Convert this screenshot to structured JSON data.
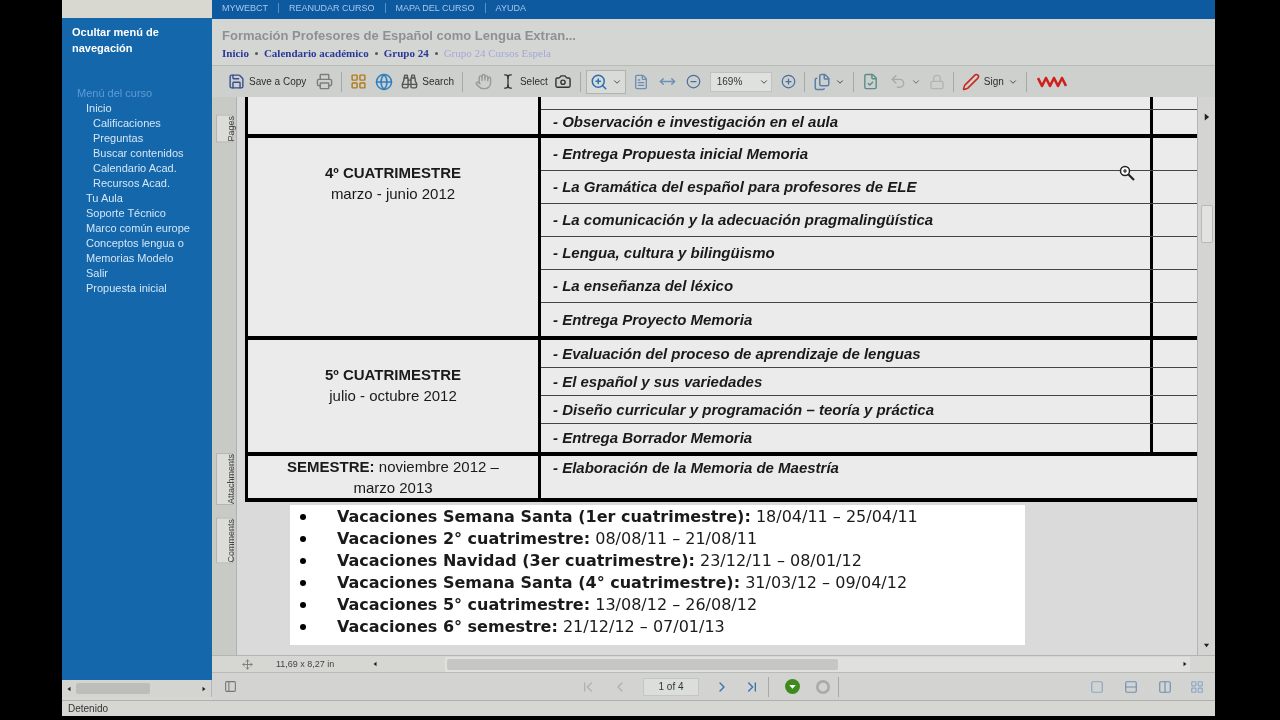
{
  "top_links": [
    "MYWEBCT",
    "REANUDAR CURSO",
    "MAPA DEL CURSO",
    "AYUDA"
  ],
  "sidebar": {
    "hide_link": "Ocultar menú de navegación",
    "menu_title": "Menú del curso",
    "items": [
      {
        "label": "Inicio",
        "children": [
          {
            "label": "Calificaciones"
          },
          {
            "label": "Preguntas"
          },
          {
            "label": "Buscar contenidos"
          },
          {
            "label": "Calendario Acad."
          },
          {
            "label": "Recursos Acad."
          }
        ]
      },
      {
        "label": "Tu Aula"
      },
      {
        "label": "Soporte Técnico"
      },
      {
        "label": "Marco común europe"
      },
      {
        "label": "Conceptos lengua o"
      },
      {
        "label": "Memorias Modelo"
      },
      {
        "label": "Salir"
      },
      {
        "label": "Propuesta inicial"
      }
    ]
  },
  "header": {
    "title": "Formación Profesores de Español como Lengua Extran...",
    "breadcrumb": [
      {
        "label": "Inicio",
        "current": false
      },
      {
        "label": "Calendario académico",
        "current": false
      },
      {
        "label": "Grupo 24",
        "current": false
      },
      {
        "label": "Grupo 24 Cursos Espela",
        "current": true
      }
    ]
  },
  "toolbar": {
    "save_label": "Save a Copy",
    "search_label": "Search",
    "select_label": "Select",
    "zoom_field": "169%",
    "undo": {
      "disabled": true
    },
    "lock": {
      "disabled": true
    },
    "sign_label": "Sign"
  },
  "side_tabs": [
    "Pages",
    "Attachments",
    "Comments"
  ],
  "document": {
    "schedule": [
      {
        "kind": "continued",
        "items": [
          "- Observación e investigación en el aula"
        ]
      },
      {
        "kind": "term",
        "period": "4º CUATRIMESTRE",
        "dates": "marzo - junio 2012",
        "items": [
          "- Entrega Propuesta inicial Memoria",
          "- La Gramática del español para profesores de ELE",
          "- La comunicación y la adecuación pragmalingüística",
          "- Lengua, cultura y bilingüismo",
          "- La enseñanza del léxico",
          "- Entrega Proyecto Memoria"
        ]
      },
      {
        "kind": "term",
        "period": "5º CUATRIMESTRE",
        "dates": "julio - octubre 2012",
        "items": [
          "- Evaluación del proceso de aprendizaje de lenguas",
          "- El español y sus variedades",
          "- Diseño curricular y programación – teoría y práctica",
          "- Entrega Borrador Memoria"
        ]
      },
      {
        "kind": "semester",
        "period": "**SEMESTRE:** noviembre 2012 – marzo 2013",
        "items": [
          "- Elaboración de la Memoria de Maestría"
        ]
      }
    ],
    "holidays": [
      "**Vacaciones Semana Santa (1er cuatrimestre):** 18/04/11 – 25/04/11",
      "**Vacaciones 2° cuatrimestre:** 08/08/11 – 21/08/11",
      "**Vacaciones Navidad (3er cuatrimestre):** 23/12/11 – 08/01/12",
      "**Vacaciones Semana Santa (4° cuatrimestre):** 31/03/12 – 09/04/12",
      "**Vacaciones 5° cuatrimestre:** 13/08/12 – 26/08/12",
      "**Vacaciones 6° semestre:** 21/12/12 – 07/01/13"
    ]
  },
  "page_size": "11,69 x 8,27 in",
  "navigation": {
    "page_field": "1 of 4",
    "first_page": {
      "disabled": true
    },
    "previous_page": {
      "disabled": true
    },
    "next_page": {
      "disabled": false
    },
    "last_page": {
      "disabled": false
    }
  },
  "status_bar": "Detenido"
}
